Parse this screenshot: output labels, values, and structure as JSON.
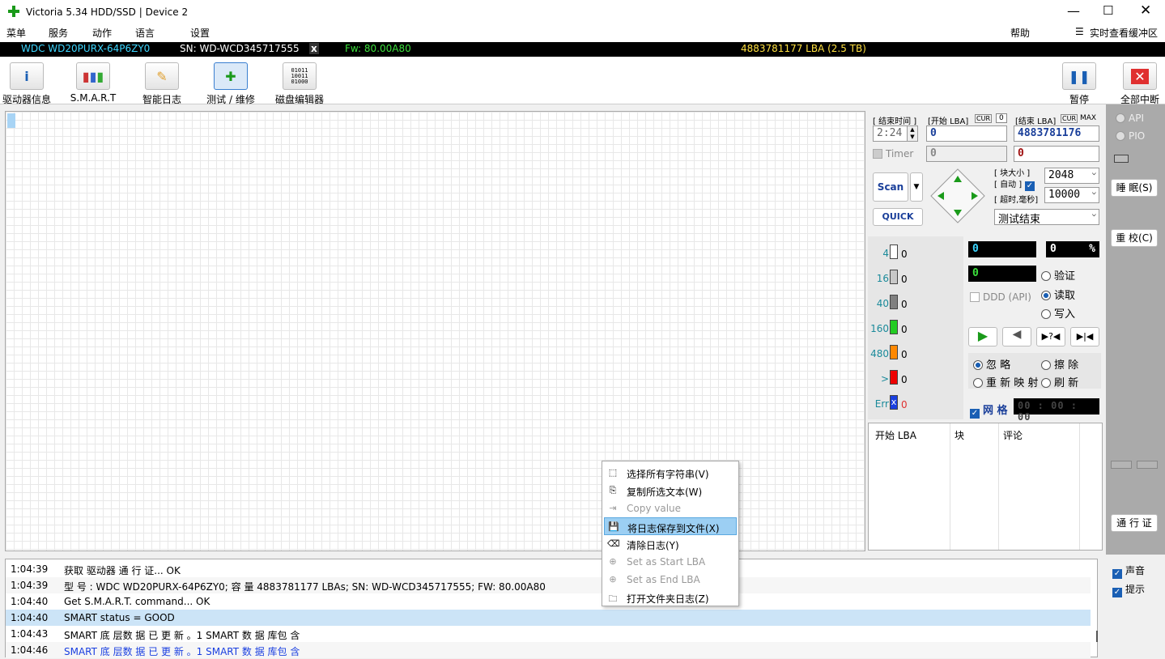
{
  "title": "Victoria 5.34 HDD/SSD | Device 2",
  "menu": [
    "菜单",
    "服务",
    "动作",
    "语言",
    "设置"
  ],
  "menu_right": {
    "help": "帮助",
    "buffer": "实时查看缓冲区"
  },
  "info": {
    "model": "WDC WD20PURX-64P6ZY0",
    "sn": "SN: WD-WCD345717555",
    "x": "x",
    "fw": "Fw: 80.00A80",
    "lba": "4883781177 LBA (2.5 TB)"
  },
  "toolbar": {
    "drive_info": "驱动器信息",
    "smart": "S.M.A.R.T",
    "smart_log": "智能日志",
    "test": "测试 / 维修",
    "disk_editor": "磁盘编辑器",
    "pause": "暂停",
    "stop_all": "全部中断"
  },
  "scan": {
    "end_time_label": "[ 结束时间 ]",
    "start_lba_label": "[开始 LBA]",
    "cur": "CUR",
    "cur_val": "0",
    "end_lba_label": "[结束 LBA]",
    "cur2": "CUR",
    "max": "MAX",
    "time": "2:24",
    "start_lba": "0",
    "end_lba": "4883781176",
    "timer": "Timer",
    "timer_val": "0",
    "end_val": "0",
    "scan": "Scan",
    "quick": "QUICK",
    "block_label": "[ 块大小 ]",
    "auto_label": "[ 自动 ]",
    "timeout_label": "[ 超时,毫秒]",
    "block": "2048",
    "timeout": "10000",
    "end_action": "测试结束"
  },
  "blocks": [
    {
      "label": "4",
      "count": "0",
      "color": "#ffffff"
    },
    {
      "label": "16",
      "count": "0",
      "color": "#c8c8c8"
    },
    {
      "label": "40",
      "count": "0",
      "color": "#808080"
    },
    {
      "label": "160",
      "count": "0",
      "color": "#22cc22"
    },
    {
      "label": "480",
      "count": "0",
      "color": "#ff8800"
    },
    {
      "label": ">",
      "count": "0",
      "color": "#ee0000"
    },
    {
      "label": "Err",
      "count": "0",
      "color": "#1a3fe0"
    }
  ],
  "counters": {
    "c1": "0",
    "pct": "0",
    "pct_sign": "%",
    "c2": "0",
    "ddd": "DDD (API)",
    "verify": "验证",
    "read": "读取",
    "write": "写入"
  },
  "actions": {
    "ignore": "忽 略",
    "erase": "擦 除",
    "remap": "重 新 映 射",
    "refresh": "刷 新",
    "grid": "网 格",
    "timer_display": "00 : 00 : 00"
  },
  "table": {
    "headers": [
      "开始 LBA",
      "块",
      "评论"
    ]
  },
  "right": {
    "api": "API",
    "pio": "PIO",
    "sleep": "睡 眠(S)",
    "recal": "重 校(C)",
    "pass": "通 行 证",
    "sound": "声音",
    "hints": "提示"
  },
  "log": [
    {
      "time": "1:04:39",
      "msg": "获取 驱动器 通 行 证... OK"
    },
    {
      "time": "1:04:39",
      "msg": "型 号 : WDC WD20PURX-64P6ZY0; 容 量 4883781177 LBAs; SN: WD-WCD345717555; FW: 80.00A80"
    },
    {
      "time": "1:04:40",
      "msg": "Get S.M.A.R.T. command... OK"
    },
    {
      "time": "1:04:40",
      "msg": "SMART status = GOOD"
    },
    {
      "time": "1:04:43",
      "msg": "SMART 底 层数 据 已 更 新 。1 SMART 数 据 库包 含"
    },
    {
      "time": "1:04:46",
      "msg": "SMART 底 层数 据 已 更 新 。1 SMART 数 据 库包 含"
    }
  ],
  "context_menu": [
    {
      "label": "选择所有字符串(V)",
      "icon": "select-icon",
      "disabled": false,
      "selected": false
    },
    {
      "label": "复制所选文本(W)",
      "icon": "copy-icon",
      "disabled": false,
      "selected": false
    },
    {
      "label": "Copy value",
      "icon": "copy-value-icon",
      "disabled": true,
      "selected": false
    },
    {
      "label": "将日志保存到文件(X)",
      "icon": "save-icon",
      "disabled": false,
      "selected": true
    },
    {
      "label": "清除日志(Y)",
      "icon": "eraser-icon",
      "disabled": false,
      "selected": false
    },
    {
      "label": "Set as Start LBA",
      "icon": "plus-circle-icon",
      "disabled": true,
      "selected": false
    },
    {
      "label": "Set as End LBA",
      "icon": "plus-circle-filled-icon",
      "disabled": true,
      "selected": false
    },
    {
      "label": "打开文件夹日志(Z)",
      "icon": "folder-icon",
      "disabled": false,
      "selected": false
    }
  ]
}
